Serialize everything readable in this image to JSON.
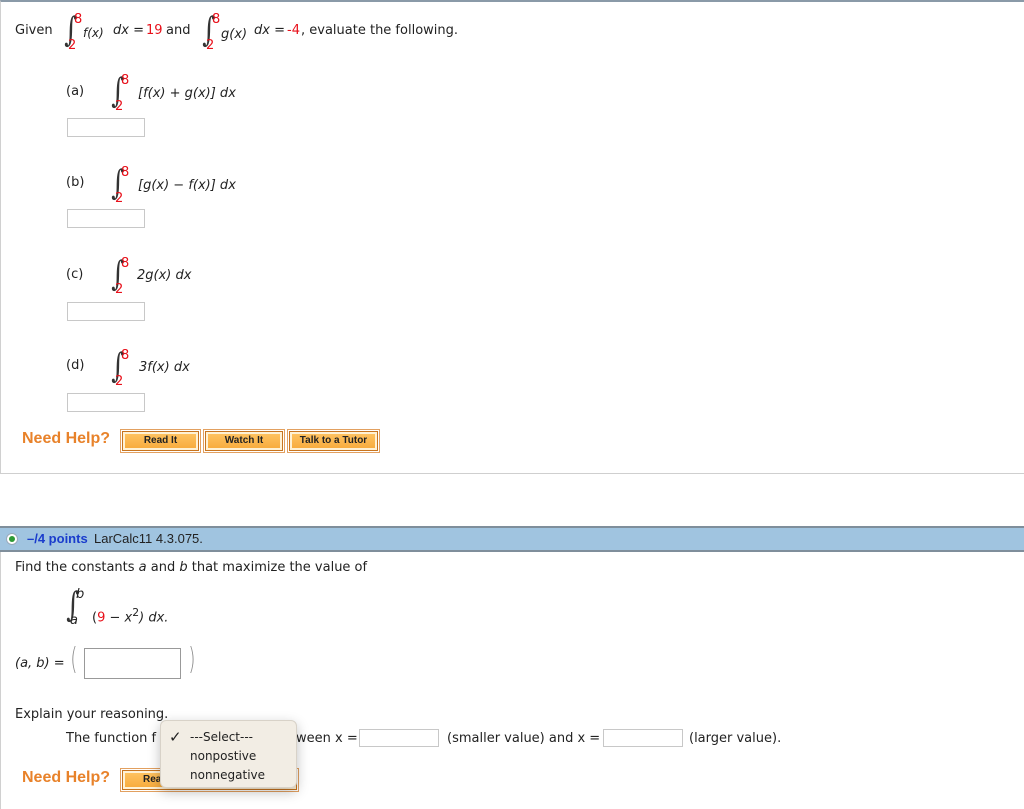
{
  "q1": {
    "intro_given": "Given",
    "f_expr": "f(x)",
    "dx1": "dx =",
    "f_value": "19",
    "and": "and",
    "g_expr": "g(x)",
    "dx2": "dx =",
    "g_value": "-4",
    "tail": ", evaluate the following.",
    "limits": {
      "upper": "8",
      "lower": "2"
    },
    "parts": [
      {
        "label": "(a)",
        "expr": "[f(x) + g(x)] dx",
        "answer": ""
      },
      {
        "label": "(b)",
        "expr": "[g(x) − f(x)] dx",
        "answer": ""
      },
      {
        "label": "(c)",
        "expr": "2g(x) dx",
        "answer": ""
      },
      {
        "label": "(d)",
        "expr": "3f(x) dx",
        "answer": ""
      }
    ],
    "help": {
      "label": "Need Help?",
      "buttons": [
        "Read It",
        "Watch It",
        "Talk to a Tutor"
      ]
    }
  },
  "q2": {
    "points": "–/4 points",
    "code": "LarCalc11 4.3.075.",
    "prompt_pre": "Find the constants ",
    "a": "a",
    "and": " and ",
    "b": "b",
    "prompt_post": " that maximize the value of",
    "integral": {
      "upper": "b",
      "lower": "a",
      "open": "(",
      "nine": "9",
      "minus_x": " − x",
      "sup": "2",
      "close_dx": ") dx."
    },
    "ab_label": "(a, b) =",
    "ab_answer": "",
    "explain": "Explain your reasoning.",
    "sentence_start": "The function f",
    "sentence_mid": "ween x =",
    "smaller": "(smaller value) and x =",
    "larger": "(larger value).",
    "x_small_answer": "",
    "x_large_answer": "",
    "dropdown": {
      "selected": "---Select---",
      "options": [
        "---Select---",
        "nonpostive",
        "nonnegative"
      ]
    },
    "help": {
      "label": "Need Help?",
      "buttons": [
        "Read It"
      ]
    }
  },
  "colors": {
    "red_value": "#e8101a",
    "help_orange": "#e8822a",
    "header_blue": "#a0c4e0",
    "points_blue": "#1a3ccc"
  }
}
